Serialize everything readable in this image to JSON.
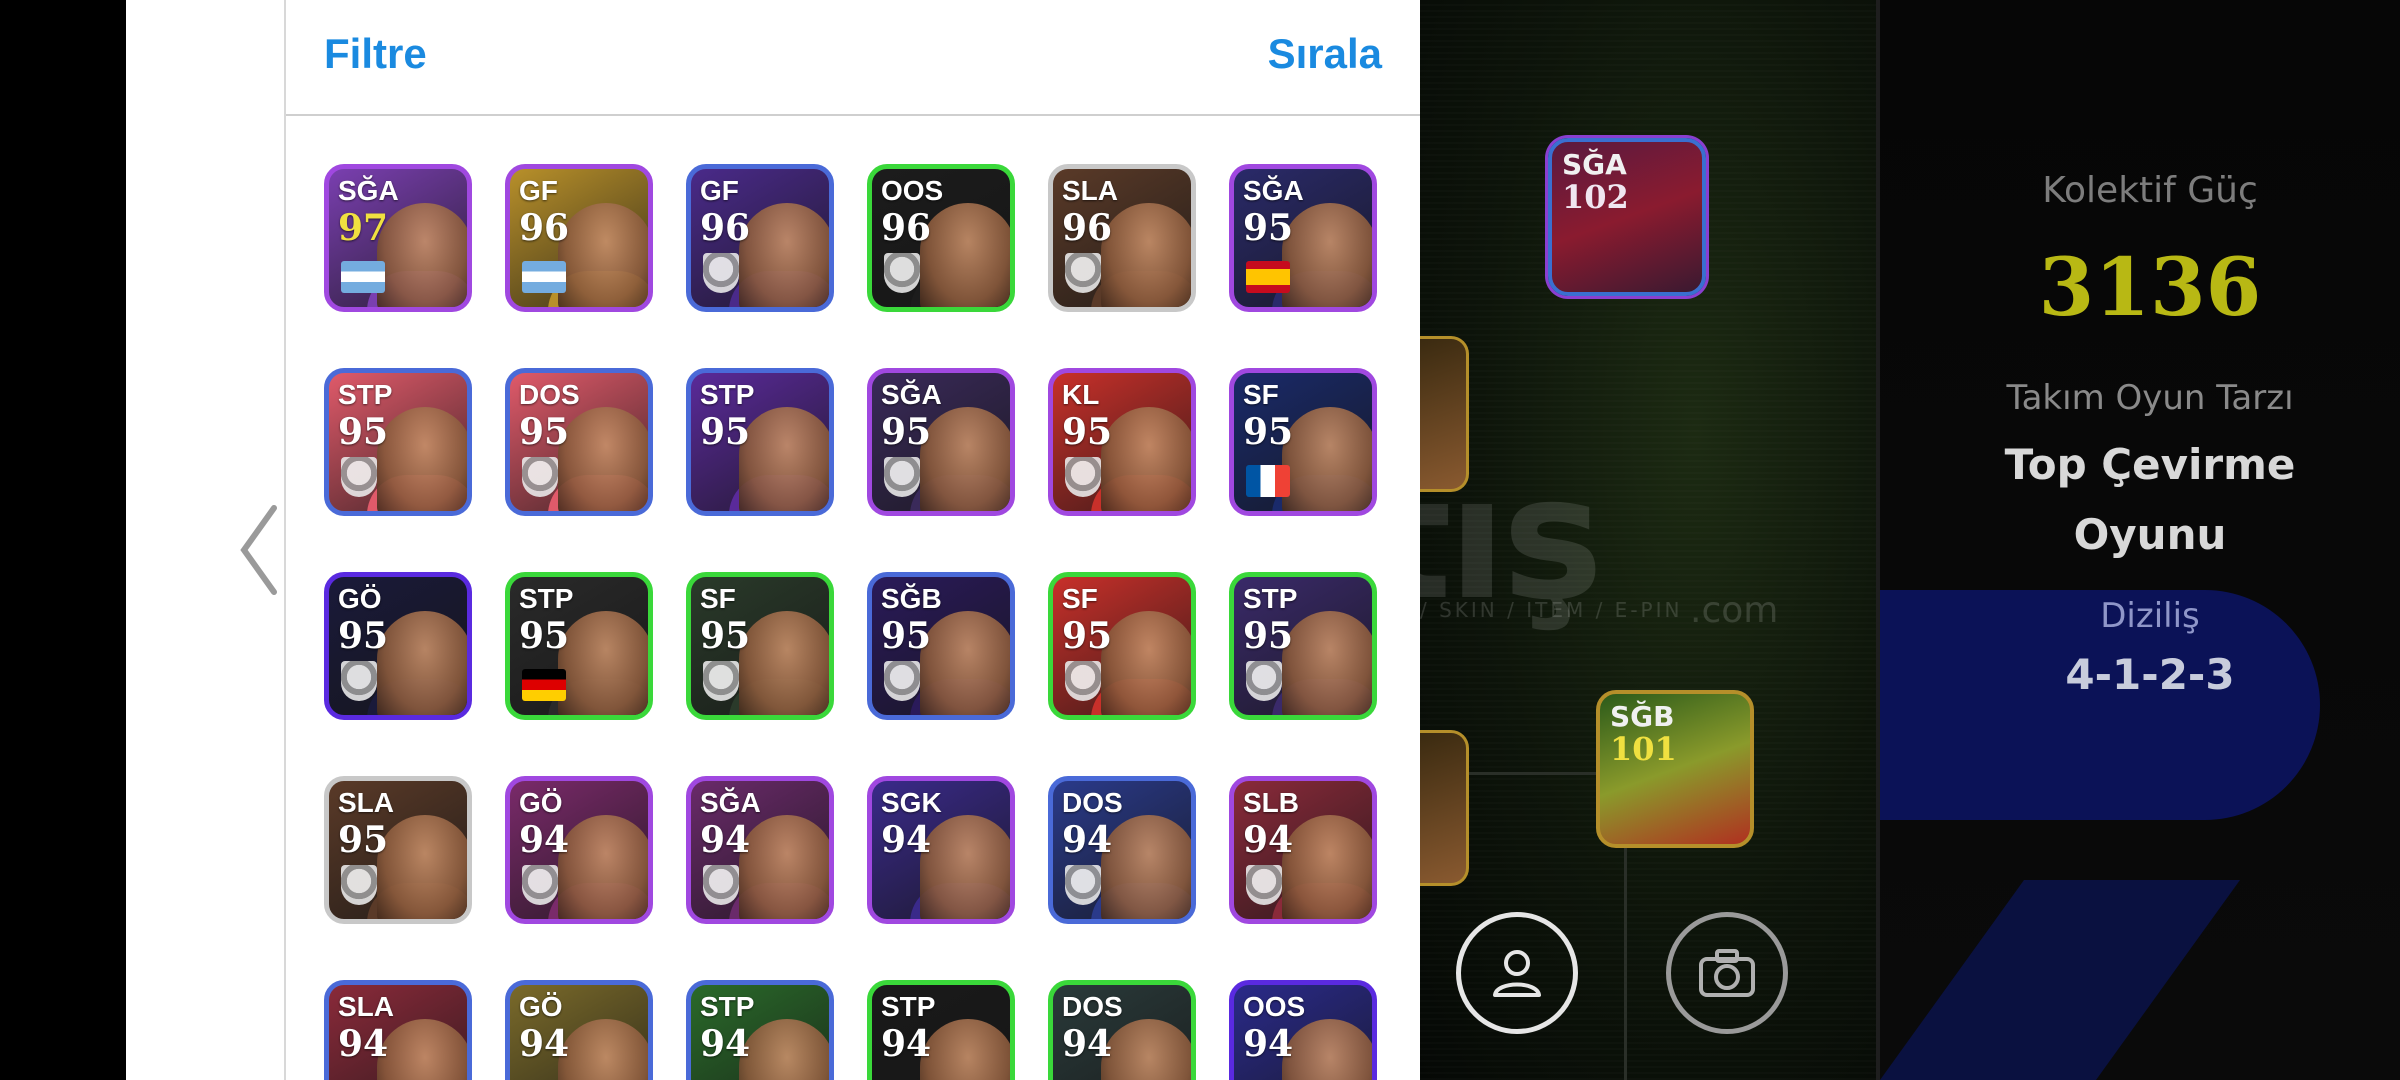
{
  "header": {
    "filter_label": "Filtre",
    "sort_label": "Sırala"
  },
  "team_panel": {
    "collective_power_label": "Kolektif Güç",
    "collective_power_value": "3136",
    "team_style_label": "Takım Oyun Tarzı",
    "team_style_value_line1": "Top Çevirme",
    "team_style_value_line2": "Oyunu",
    "formation_label": "Diziliş",
    "formation_value": "4-1-2-3"
  },
  "field_cards": [
    {
      "position": "SĞA",
      "rating": "102"
    },
    {
      "position": "SĞB",
      "rating": "101"
    }
  ],
  "watermark": {
    "main": "atış",
    "sub": "/ SKIN / ITEM / E-PIN",
    "com": ".com"
  },
  "players": [
    {
      "position": "SĞA",
      "rating": "97",
      "frame": "#a048e0",
      "bg": "#7a3fb0",
      "rating_color": "#f0e040",
      "badge": "flag-argentina"
    },
    {
      "position": "GF",
      "rating": "96",
      "frame": "#a048e0",
      "bg": "#b8902a",
      "rating_color": "#ffffff",
      "badge": "flag-argentina"
    },
    {
      "position": "GF",
      "rating": "96",
      "frame": "#4a6ad8",
      "bg": "#4a2a8a",
      "rating_color": "#ffffff",
      "badge": "club-crest"
    },
    {
      "position": "OOS",
      "rating": "96",
      "frame": "#3ad83a",
      "bg": "#1c1c1c",
      "rating_color": "#ffffff",
      "badge": "club-crest"
    },
    {
      "position": "SLA",
      "rating": "96",
      "frame": "#c8c8c8",
      "bg": "#5a3a28",
      "rating_color": "#ffffff",
      "badge": "club-crest"
    },
    {
      "position": "SĞA",
      "rating": "95",
      "frame": "#a048e0",
      "bg": "#2a2a6a",
      "rating_color": "#ffffff",
      "badge": "flag-spain"
    },
    {
      "position": "STP",
      "rating": "95",
      "frame": "#4a6ad8",
      "bg": "#e05a6a",
      "rating_color": "#ffffff",
      "badge": "club-crest"
    },
    {
      "position": "DOS",
      "rating": "95",
      "frame": "#4a6ad8",
      "bg": "#e05a6a",
      "rating_color": "#ffffff",
      "badge": "club-crest"
    },
    {
      "position": "STP",
      "rating": "95",
      "frame": "#4a6ad8",
      "bg": "#5a2a9a",
      "rating_color": "#ffffff",
      "badge": "none"
    },
    {
      "position": "SĞA",
      "rating": "95",
      "frame": "#a048e0",
      "bg": "#3a2a5a",
      "rating_color": "#ffffff",
      "badge": "club-crest"
    },
    {
      "position": "KL",
      "rating": "95",
      "frame": "#a048e0",
      "bg": "#c8302a",
      "rating_color": "#ffffff",
      "badge": "club-crest"
    },
    {
      "position": "SF",
      "rating": "95",
      "frame": "#a048e0",
      "bg": "#1a2a6a",
      "rating_color": "#ffffff",
      "badge": "flag-france"
    },
    {
      "position": "GÖ",
      "rating": "95",
      "frame": "#5a2ae0",
      "bg": "#1a1a3a",
      "rating_color": "#ffffff",
      "badge": "club-crest"
    },
    {
      "position": "STP",
      "rating": "95",
      "frame": "#3ad83a",
      "bg": "#2a2a2a",
      "rating_color": "#ffffff",
      "badge": "flag-germany"
    },
    {
      "position": "SF",
      "rating": "95",
      "frame": "#3ad83a",
      "bg": "#2a3a2a",
      "rating_color": "#ffffff",
      "badge": "club-crest"
    },
    {
      "position": "SĞB",
      "rating": "95",
      "frame": "#4a6ad8",
      "bg": "#2a1a5a",
      "rating_color": "#ffffff",
      "badge": "club-crest"
    },
    {
      "position": "SF",
      "rating": "95",
      "frame": "#3ad83a",
      "bg": "#c8302a",
      "rating_color": "#ffffff",
      "badge": "club-crest"
    },
    {
      "position": "STP",
      "rating": "95",
      "frame": "#3ad83a",
      "bg": "#3a2a6a",
      "rating_color": "#ffffff",
      "badge": "club-crest"
    },
    {
      "position": "SLA",
      "rating": "95",
      "frame": "#c8c8c8",
      "bg": "#5a3a28",
      "rating_color": "#ffffff",
      "badge": "club-crest"
    },
    {
      "position": "GÖ",
      "rating": "94",
      "frame": "#a048e0",
      "bg": "#7a2a6a",
      "rating_color": "#ffffff",
      "badge": "club-crest"
    },
    {
      "position": "SĞA",
      "rating": "94",
      "frame": "#a048e0",
      "bg": "#6a2a6a",
      "rating_color": "#ffffff",
      "badge": "club-crest"
    },
    {
      "position": "SGK",
      "rating": "94",
      "frame": "#a048e0",
      "bg": "#3a2a8a",
      "rating_color": "#ffffff",
      "badge": "none"
    },
    {
      "position": "DOS",
      "rating": "94",
      "frame": "#4a6ad8",
      "bg": "#2a3a8a",
      "rating_color": "#ffffff",
      "badge": "club-crest"
    },
    {
      "position": "SLB",
      "rating": "94",
      "frame": "#a048e0",
      "bg": "#8a2a3a",
      "rating_color": "#ffffff",
      "badge": "club-crest"
    },
    {
      "position": "SLA",
      "rating": "94",
      "frame": "#4a6ad8",
      "bg": "#8a2a3a",
      "rating_color": "#ffffff",
      "badge": "none"
    },
    {
      "position": "GÖ",
      "rating": "94",
      "frame": "#4a6ad8",
      "bg": "#7a6a2a",
      "rating_color": "#ffffff",
      "badge": "none"
    },
    {
      "position": "STP",
      "rating": "94",
      "frame": "#4a6ad8",
      "bg": "#2a6a2a",
      "rating_color": "#ffffff",
      "badge": "none"
    },
    {
      "position": "STP",
      "rating": "94",
      "frame": "#3ad83a",
      "bg": "#1a1a1a",
      "rating_color": "#ffffff",
      "badge": "none"
    },
    {
      "position": "DOS",
      "rating": "94",
      "frame": "#3ad83a",
      "bg": "#2a3a3a",
      "rating_color": "#ffffff",
      "badge": "none"
    },
    {
      "position": "OOS",
      "rating": "94",
      "frame": "#5a2ae0",
      "bg": "#2a2a8a",
      "rating_color": "#ffffff",
      "badge": "none"
    }
  ]
}
